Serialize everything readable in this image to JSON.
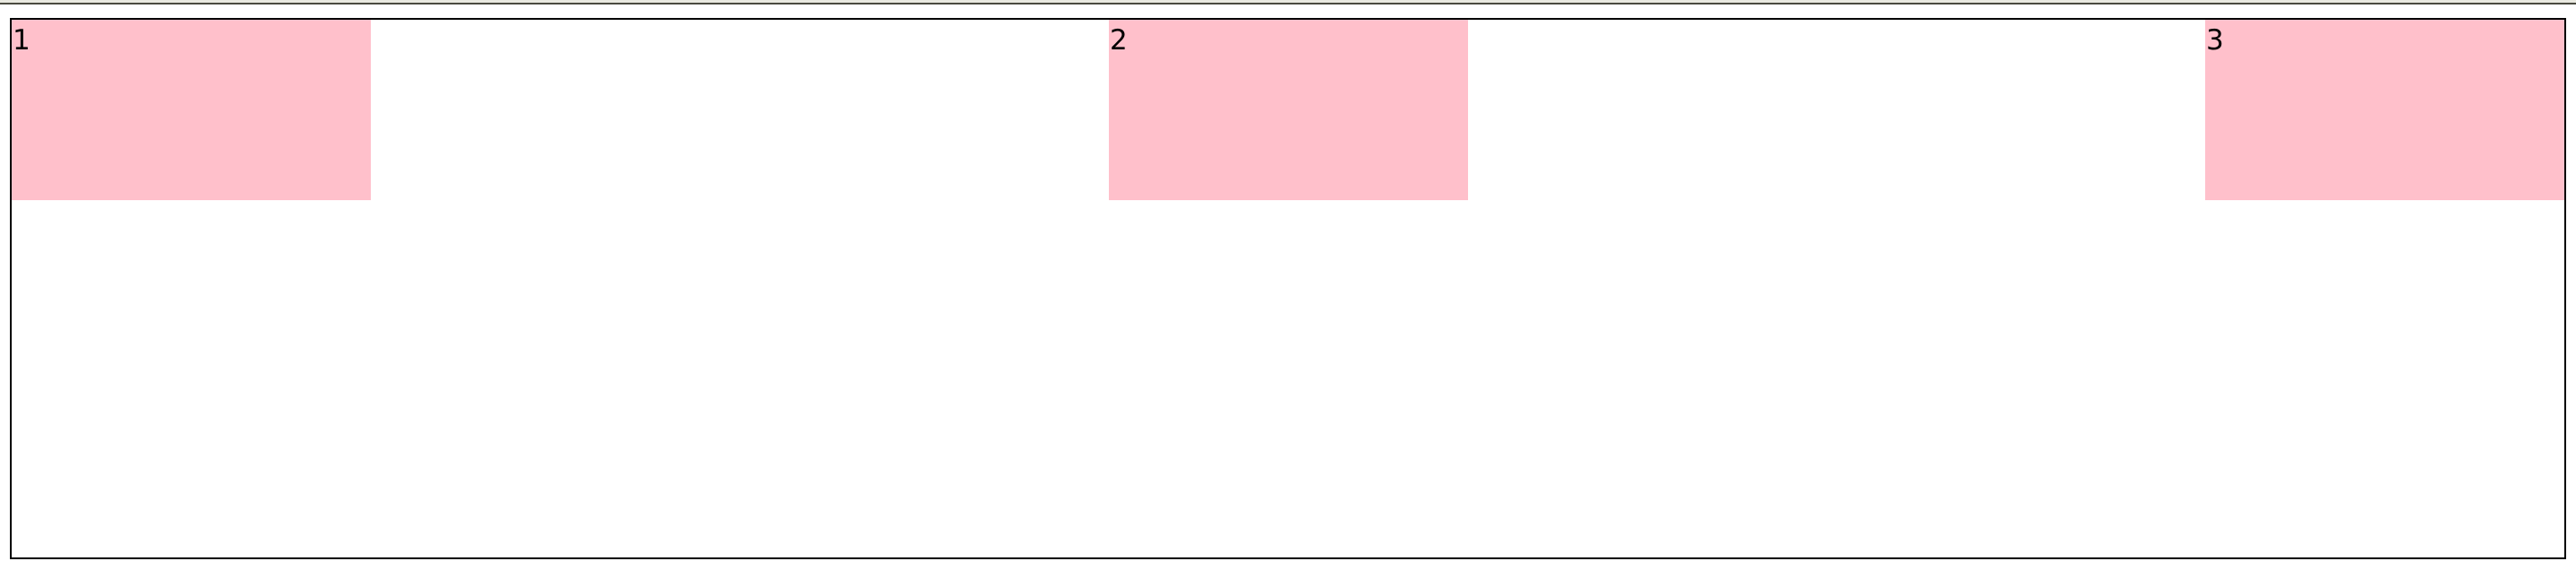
{
  "colors": {
    "container_border": "#000000",
    "box_background": "#ffc0cb",
    "box_text": "#000000",
    "page_background": "#ffffff",
    "top_bar": "#e9e9e0",
    "top_bar_border": "#4a4a40"
  },
  "boxes": [
    {
      "label": "1"
    },
    {
      "label": "2"
    },
    {
      "label": "3"
    }
  ]
}
